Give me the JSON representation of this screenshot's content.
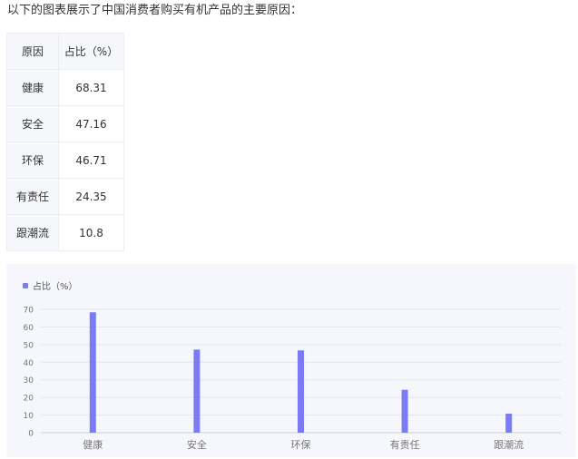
{
  "intro_text": "以下的图表展示了中国消费者购买有机产品的主要原因：",
  "table": {
    "headers": [
      "原因",
      "占比（%）"
    ],
    "rows": [
      {
        "label": "健康",
        "value": "68.31"
      },
      {
        "label": "安全",
        "value": "47.16"
      },
      {
        "label": "环保",
        "value": "46.71"
      },
      {
        "label": "有责任",
        "value": "24.35"
      },
      {
        "label": "跟潮流",
        "value": "10.8"
      }
    ]
  },
  "colors": {
    "bar": "#7b7bf6",
    "grid": "#e3e5ee",
    "axis_text": "#777777",
    "panel": "#f6f7fc"
  },
  "chart_data": {
    "type": "bar",
    "categories": [
      "健康",
      "安全",
      "环保",
      "有责任",
      "跟潮流"
    ],
    "series": [
      {
        "name": "占比（%）",
        "values": [
          68.31,
          47.16,
          46.71,
          24.35,
          10.8
        ]
      }
    ],
    "yticks": [
      0,
      10,
      20,
      30,
      40,
      50,
      60,
      70
    ],
    "ylim": [
      0,
      70
    ],
    "grid": true,
    "legend_position": "top-left"
  }
}
